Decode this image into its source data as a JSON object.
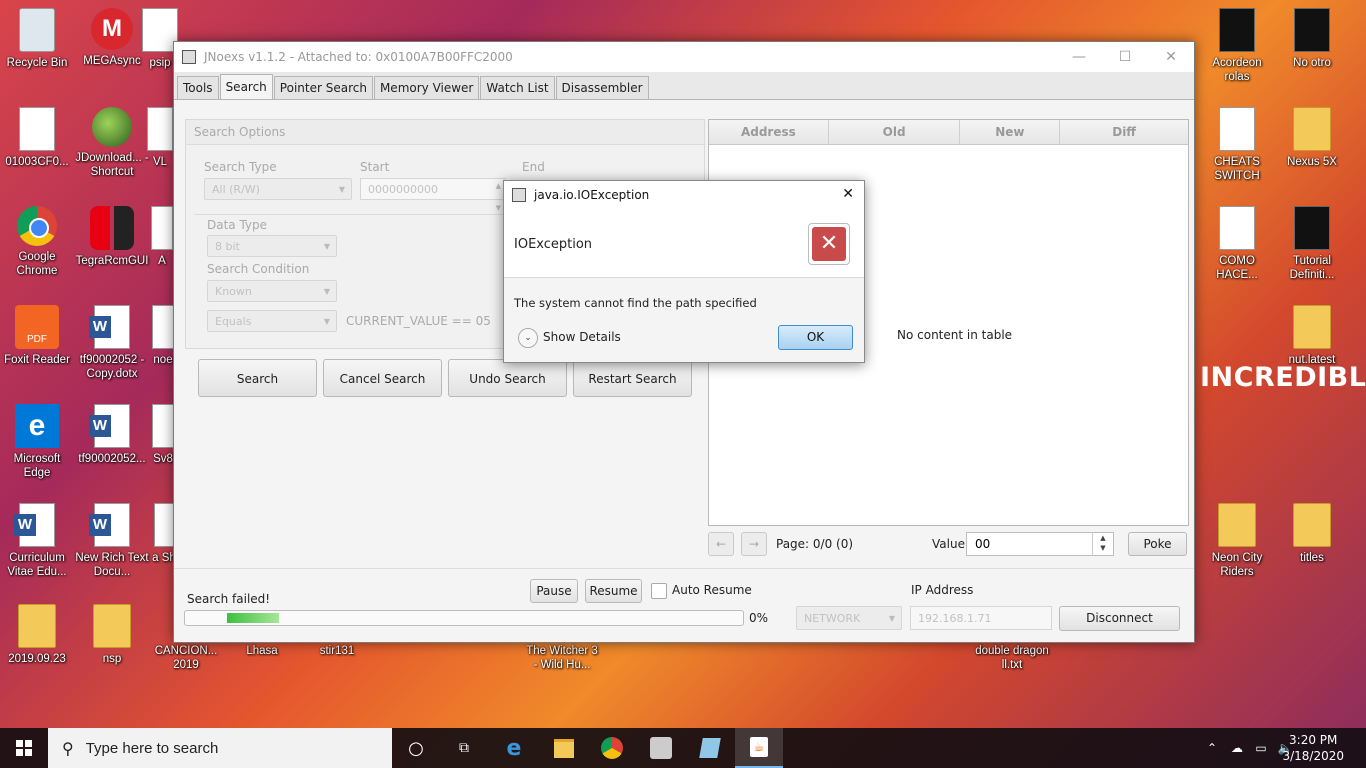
{
  "desktop": {
    "left_icons": [
      {
        "label": "Recycle Bin"
      },
      {
        "label": "MEGAsync"
      },
      {
        "label": "psip"
      },
      {
        "label": "01003CF0..."
      },
      {
        "label": "JDownload... - Shortcut"
      },
      {
        "label": "VL"
      },
      {
        "label": "Google Chrome"
      },
      {
        "label": "TegraRcmGUI"
      },
      {
        "label": "A"
      },
      {
        "label": "Foxit Reader"
      },
      {
        "label": "tf90002052 - Copy.dotx"
      },
      {
        "label": "noe"
      },
      {
        "label": "Microsoft Edge"
      },
      {
        "label": "tf90002052..."
      },
      {
        "label": "Sv8"
      },
      {
        "label": "Curriculum Vitae Edu..."
      },
      {
        "label": "New Rich Text Docu..."
      },
      {
        "label": "a Sh"
      },
      {
        "label": "2019.09.23"
      },
      {
        "label": "nsp"
      },
      {
        "label": "CANCION... 2019"
      },
      {
        "label": "Lhasa"
      },
      {
        "label": "stir131"
      },
      {
        "label": "The Witcher 3 - Wild Hu..."
      },
      {
        "label": "double dragon ll.txt"
      }
    ],
    "right_icons": [
      {
        "label": "Acordeon rolas"
      },
      {
        "label": "No otro"
      },
      {
        "label": "CHEATS SWITCH"
      },
      {
        "label": "Nexus 5X"
      },
      {
        "label": "COMO HACE..."
      },
      {
        "label": "Tutorial Definiti..."
      },
      {
        "label": "nut.latest"
      },
      {
        "label": "Neon City Riders"
      },
      {
        "label": "titles"
      }
    ],
    "wallpaper_text": "INCREDIBLE"
  },
  "window": {
    "title": "JNoexs v1.1.2 - Attached to: 0x0100A7B00FFC2000",
    "controls": {
      "minimize": "—",
      "maximize": "☐",
      "close": "✕"
    },
    "tabs": [
      {
        "label": "Tools"
      },
      {
        "label": "Search"
      },
      {
        "label": "Pointer Search"
      },
      {
        "label": "Memory Viewer"
      },
      {
        "label": "Watch List"
      },
      {
        "label": "Disassembler"
      }
    ],
    "search_options": {
      "heading": "Search Options",
      "search_type_label": "Search Type",
      "search_type_value": "All (R/W)",
      "start_label": "Start",
      "start_value": "0000000000",
      "end_label": "End",
      "data_type_label": "Data Type",
      "data_type_value": "8 bit",
      "search_condition_label": "Search Condition",
      "search_condition_value": "Known",
      "compare_value": "Equals",
      "condition_text": "CURRENT_VALUE == 05"
    },
    "buttons": {
      "search": "Search",
      "cancel_search": "Cancel Search",
      "undo_search": "Undo Search",
      "restart_search": "Restart Search"
    },
    "results_table": {
      "columns": [
        "Address",
        "Old",
        "New",
        "Diff"
      ],
      "empty_text": "No content in table"
    },
    "paging": {
      "prev": "←",
      "next": "→",
      "page_text": "Page: 0/0 (0)",
      "value_label": "Value:",
      "value": "00",
      "poke": "Poke"
    },
    "status_bar": {
      "status_text": "Search failed!",
      "pause": "Pause",
      "resume": "Resume",
      "auto_resume": "Auto Resume",
      "progress_percent_text": "0%",
      "progress_fraction": 0.0,
      "connection_type": "NETWORK",
      "ip_label": "IP Address",
      "ip_value": "192.168.1.71",
      "disconnect": "Disconnect"
    }
  },
  "dialog": {
    "title": "java.io.IOException",
    "close": "✕",
    "header": "IOException",
    "message": "The system cannot find the path specified",
    "show_details": "Show Details",
    "ok": "OK"
  },
  "taskbar": {
    "search_placeholder": "Type here to search",
    "time": "3:20 PM",
    "date": "3/18/2020"
  }
}
